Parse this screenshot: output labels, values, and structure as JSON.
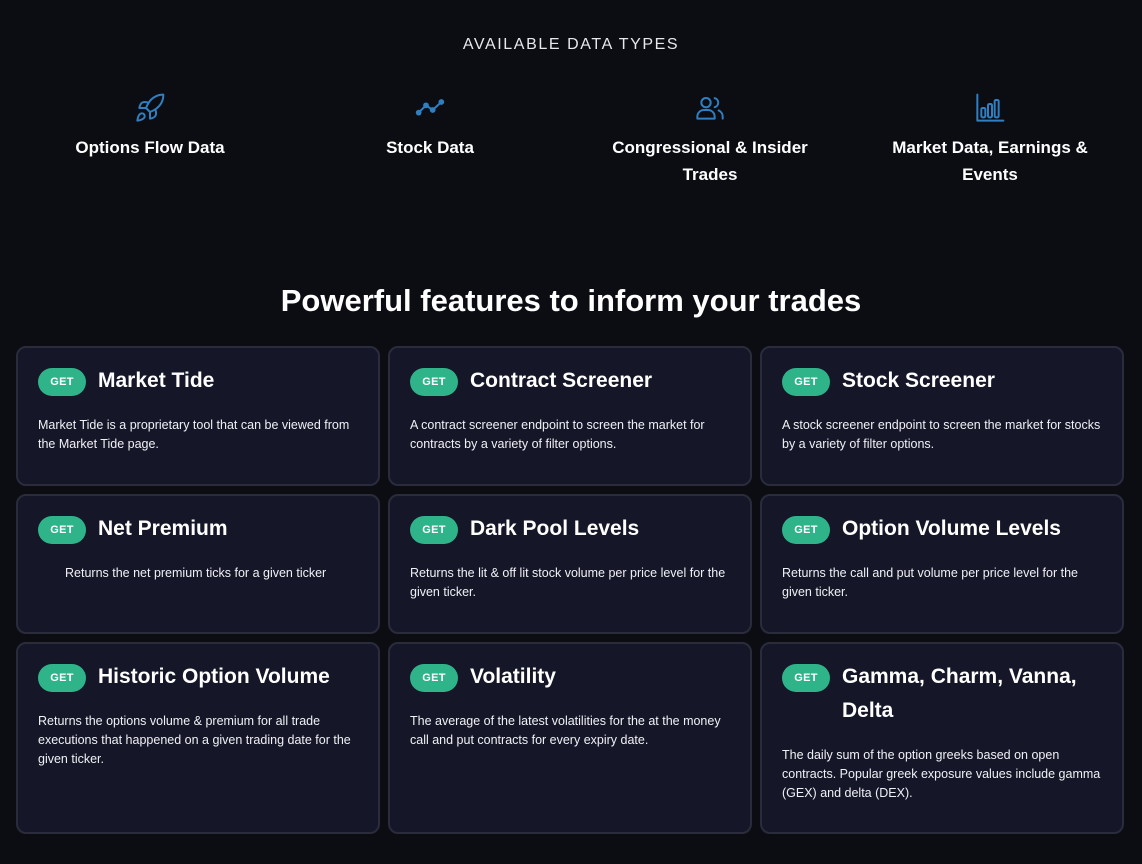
{
  "data_types": {
    "heading": "AVAILABLE DATA TYPES",
    "items": [
      {
        "label": "Options Flow Data",
        "icon": "rocket-icon"
      },
      {
        "label": "Stock Data",
        "icon": "line-chart-icon"
      },
      {
        "label": "Congressional & Insider Trades",
        "icon": "users-icon"
      },
      {
        "label": "Market Data, Earnings & Events",
        "icon": "bar-chart-icon"
      }
    ]
  },
  "features": {
    "title": "Powerful features to inform your trades",
    "badge_label": "GET",
    "badge_color": "#2fb389",
    "icon_color": "#2f7fc1",
    "cards": [
      {
        "title": "Market Tide",
        "description": "Market Tide is a proprietary tool that can be viewed from the Market Tide page."
      },
      {
        "title": "Contract Screener",
        "description": "A contract screener endpoint to screen the market for contracts by a variety of filter options."
      },
      {
        "title": "Stock Screener",
        "description": "A stock screener endpoint to screen the market for stocks by a variety of filter options."
      },
      {
        "title": "Net Premium",
        "description": "Returns the net premium ticks for a given ticker"
      },
      {
        "title": "Dark Pool Levels",
        "description": "Returns the lit & off lit stock volume per price level for the given ticker."
      },
      {
        "title": "Option Volume Levels",
        "description": "Returns the call and put volume per price level for the given ticker."
      },
      {
        "title": "Historic Option Volume",
        "description": "Returns the options volume & premium for all trade executions that happened on a given trading date for the given ticker."
      },
      {
        "title": "Volatility",
        "description": "The average of the latest volatilities for the at the money call and put contracts for every expiry date."
      },
      {
        "title": "Gamma, Charm, Vanna, Delta",
        "description": "The daily sum of the option greeks based on open contracts. Popular greek exposure values include gamma (GEX) and delta (DEX)."
      }
    ]
  }
}
